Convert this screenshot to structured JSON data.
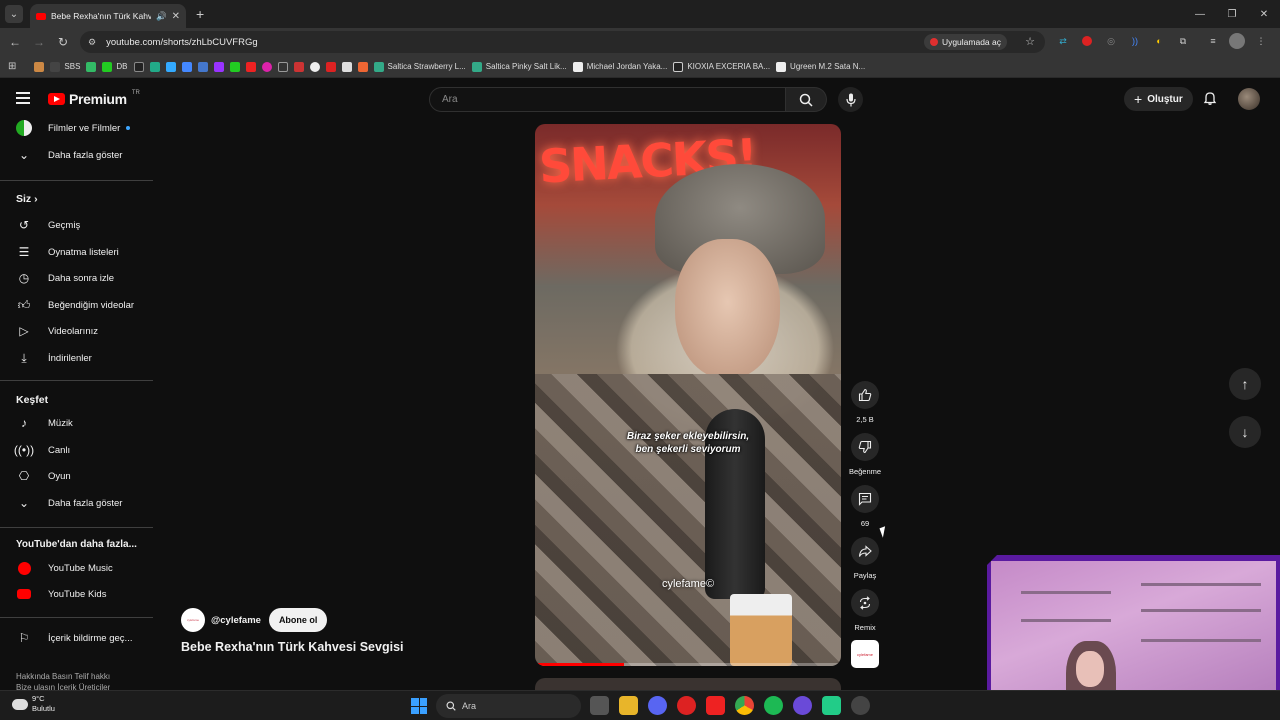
{
  "browser": {
    "tab_title": "Bebe Rexha'nın Türk Kahve",
    "url": "youtube.com/shorts/zhLbCUVFRGg",
    "open_in_app": "Uygulamada aç",
    "bookmarks": [
      "SBS",
      "DB",
      "Saltica Strawberry L...",
      "Saltica Pinky Salt Lik...",
      "Michael Jordan Yaka...",
      "KIOXIA EXCERIA BA...",
      "Ugreen M.2 Sata N..."
    ]
  },
  "masthead": {
    "logo_word": "Premium",
    "logo_sup": "TR",
    "search_placeholder": "Ara",
    "create_label": "Oluştur"
  },
  "sidebar": {
    "top_items": [
      {
        "label": "Filmler ve Filmler"
      },
      {
        "label": "Daha fazla göster"
      }
    ],
    "you_header": "Siz",
    "you_items": [
      {
        "label": "Geçmiş"
      },
      {
        "label": "Oynatma listeleri"
      },
      {
        "label": "Daha sonra izle"
      },
      {
        "label": "Beğendiğim videolar"
      },
      {
        "label": "Videolarınız"
      },
      {
        "label": "İndirilenler"
      }
    ],
    "explore_header": "Keşfet",
    "explore_items": [
      {
        "label": "Müzik"
      },
      {
        "label": "Canlı"
      },
      {
        "label": "Oyun"
      },
      {
        "label": "Daha fazla göster"
      }
    ],
    "more_header": "YouTube'dan daha fazla...",
    "more_items": [
      {
        "label": "YouTube Music"
      },
      {
        "label": "YouTube Kids"
      }
    ],
    "report_label": "İçerik bildirme geç...",
    "footer_line1": "Hakkında  Basın  Telif hakkı",
    "footer_line2": "Bize ulaşın  İçerik Üreticiler"
  },
  "short": {
    "video_text": "SNACKS!",
    "subtitle_line1": "Biraz şeker ekleyebilirsin,",
    "subtitle_line2": "ben şekerli seviyorum",
    "watermark": "cylefame©",
    "progress_percent": 29,
    "channel_handle": "@cylefame",
    "subscribe_label": "Abone ol",
    "title": "Bebe Rexha'nın Türk Kahvesi Sevgisi",
    "actions": {
      "like_count": "2,5 B",
      "dislike_label": "Beğenme",
      "comment_count": "69",
      "share_label": "Paylaş",
      "remix_label": "Remix"
    }
  },
  "taskbar": {
    "temp": "9°C",
    "condition": "Bulutlu",
    "search_label": "Ara"
  }
}
